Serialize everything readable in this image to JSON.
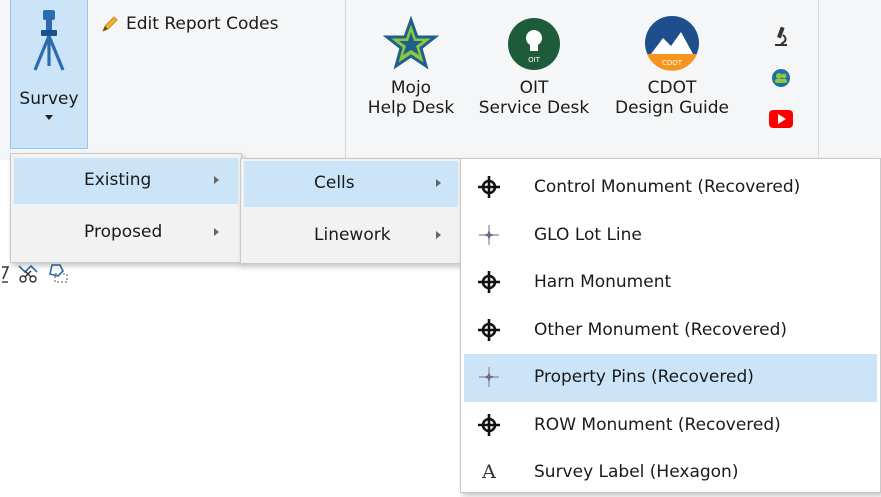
{
  "ribbon": {
    "survey": {
      "label": "Survey",
      "icon": "survey-tripod-icon"
    },
    "edit_report_codes": {
      "label": "Edit Report Codes",
      "icon": "pencil-icon"
    },
    "mojo": {
      "line1": "Mojo",
      "line2": "Help Desk",
      "icon": "mojo-star-icon"
    },
    "oit": {
      "line1": "OIT",
      "line2": "Service Desk",
      "icon": "oit-lightbulb-icon",
      "badge": "OIT"
    },
    "cdot": {
      "line1": "CDOT",
      "line2": "Design Guide",
      "icon": "cdot-logo-icon",
      "badge": "CDOT"
    },
    "small_icons": [
      "microscope-icon",
      "teams-icon",
      "youtube-icon"
    ],
    "colors": {
      "active_button": "#cce4f7",
      "ribbon_bg": "#f5f6f7",
      "youtube_red": "#ff0000"
    }
  },
  "menu_level1": {
    "items": [
      {
        "label": "Existing",
        "highlighted": true
      },
      {
        "label": "Proposed",
        "highlighted": false
      }
    ]
  },
  "menu_level2": {
    "items": [
      {
        "label": "Cells",
        "highlighted": true
      },
      {
        "label": "Linework",
        "highlighted": false
      }
    ]
  },
  "menu_level3": {
    "items": [
      {
        "label": "Control Monument (Recovered)",
        "icon": "monument-crosshair-icon",
        "highlighted": false
      },
      {
        "label": "GLO Lot Line",
        "icon": "pin-star-icon",
        "highlighted": false
      },
      {
        "label": "Harn Monument",
        "icon": "monument-crosshair-icon",
        "highlighted": false
      },
      {
        "label": "Other Monument (Recovered)",
        "icon": "monument-crosshair-icon",
        "highlighted": false
      },
      {
        "label": "Property Pins (Recovered)",
        "icon": "pin-star-icon",
        "highlighted": true
      },
      {
        "label": "ROW Monument (Recovered)",
        "icon": "monument-crosshair-icon",
        "highlighted": false
      },
      {
        "label": "Survey Label (Hexagon)",
        "icon": "text-a-icon",
        "glyph": "A",
        "highlighted": false
      }
    ]
  },
  "background_toolbar": {
    "icons": [
      "fence-icon",
      "cut-icon",
      "clip-shape-icon"
    ]
  }
}
